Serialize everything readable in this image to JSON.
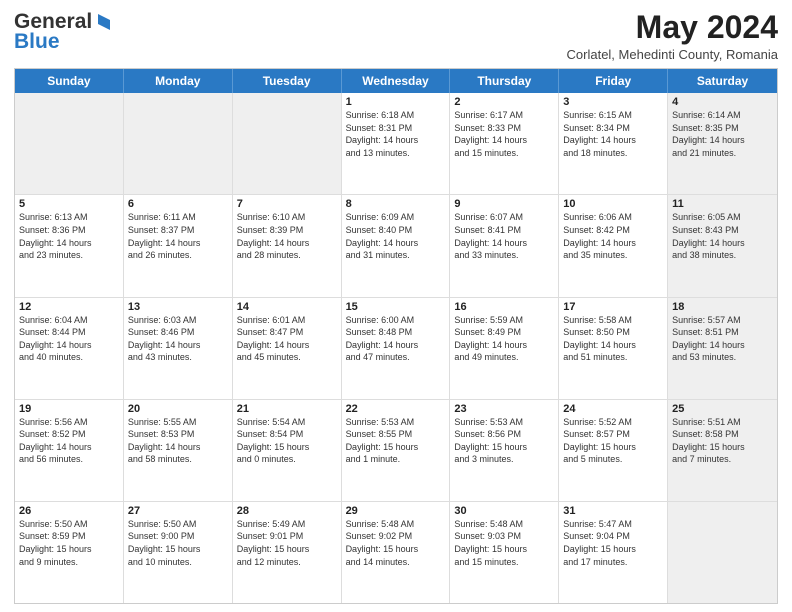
{
  "logo": {
    "line1": "General",
    "line2": "Blue"
  },
  "title": "May 2024",
  "location": "Corlatel, Mehedinti County, Romania",
  "weekdays": [
    "Sunday",
    "Monday",
    "Tuesday",
    "Wednesday",
    "Thursday",
    "Friday",
    "Saturday"
  ],
  "rows": [
    [
      {
        "day": "",
        "text": "",
        "shaded": true
      },
      {
        "day": "",
        "text": "",
        "shaded": true
      },
      {
        "day": "",
        "text": "",
        "shaded": true
      },
      {
        "day": "1",
        "text": "Sunrise: 6:18 AM\nSunset: 8:31 PM\nDaylight: 14 hours\nand 13 minutes."
      },
      {
        "day": "2",
        "text": "Sunrise: 6:17 AM\nSunset: 8:33 PM\nDaylight: 14 hours\nand 15 minutes."
      },
      {
        "day": "3",
        "text": "Sunrise: 6:15 AM\nSunset: 8:34 PM\nDaylight: 14 hours\nand 18 minutes."
      },
      {
        "day": "4",
        "text": "Sunrise: 6:14 AM\nSunset: 8:35 PM\nDaylight: 14 hours\nand 21 minutes.",
        "shaded": true
      }
    ],
    [
      {
        "day": "5",
        "text": "Sunrise: 6:13 AM\nSunset: 8:36 PM\nDaylight: 14 hours\nand 23 minutes."
      },
      {
        "day": "6",
        "text": "Sunrise: 6:11 AM\nSunset: 8:37 PM\nDaylight: 14 hours\nand 26 minutes."
      },
      {
        "day": "7",
        "text": "Sunrise: 6:10 AM\nSunset: 8:39 PM\nDaylight: 14 hours\nand 28 minutes."
      },
      {
        "day": "8",
        "text": "Sunrise: 6:09 AM\nSunset: 8:40 PM\nDaylight: 14 hours\nand 31 minutes."
      },
      {
        "day": "9",
        "text": "Sunrise: 6:07 AM\nSunset: 8:41 PM\nDaylight: 14 hours\nand 33 minutes."
      },
      {
        "day": "10",
        "text": "Sunrise: 6:06 AM\nSunset: 8:42 PM\nDaylight: 14 hours\nand 35 minutes."
      },
      {
        "day": "11",
        "text": "Sunrise: 6:05 AM\nSunset: 8:43 PM\nDaylight: 14 hours\nand 38 minutes.",
        "shaded": true
      }
    ],
    [
      {
        "day": "12",
        "text": "Sunrise: 6:04 AM\nSunset: 8:44 PM\nDaylight: 14 hours\nand 40 minutes."
      },
      {
        "day": "13",
        "text": "Sunrise: 6:03 AM\nSunset: 8:46 PM\nDaylight: 14 hours\nand 43 minutes."
      },
      {
        "day": "14",
        "text": "Sunrise: 6:01 AM\nSunset: 8:47 PM\nDaylight: 14 hours\nand 45 minutes."
      },
      {
        "day": "15",
        "text": "Sunrise: 6:00 AM\nSunset: 8:48 PM\nDaylight: 14 hours\nand 47 minutes."
      },
      {
        "day": "16",
        "text": "Sunrise: 5:59 AM\nSunset: 8:49 PM\nDaylight: 14 hours\nand 49 minutes."
      },
      {
        "day": "17",
        "text": "Sunrise: 5:58 AM\nSunset: 8:50 PM\nDaylight: 14 hours\nand 51 minutes."
      },
      {
        "day": "18",
        "text": "Sunrise: 5:57 AM\nSunset: 8:51 PM\nDaylight: 14 hours\nand 53 minutes.",
        "shaded": true
      }
    ],
    [
      {
        "day": "19",
        "text": "Sunrise: 5:56 AM\nSunset: 8:52 PM\nDaylight: 14 hours\nand 56 minutes."
      },
      {
        "day": "20",
        "text": "Sunrise: 5:55 AM\nSunset: 8:53 PM\nDaylight: 14 hours\nand 58 minutes."
      },
      {
        "day": "21",
        "text": "Sunrise: 5:54 AM\nSunset: 8:54 PM\nDaylight: 15 hours\nand 0 minutes."
      },
      {
        "day": "22",
        "text": "Sunrise: 5:53 AM\nSunset: 8:55 PM\nDaylight: 15 hours\nand 1 minute."
      },
      {
        "day": "23",
        "text": "Sunrise: 5:53 AM\nSunset: 8:56 PM\nDaylight: 15 hours\nand 3 minutes."
      },
      {
        "day": "24",
        "text": "Sunrise: 5:52 AM\nSunset: 8:57 PM\nDaylight: 15 hours\nand 5 minutes."
      },
      {
        "day": "25",
        "text": "Sunrise: 5:51 AM\nSunset: 8:58 PM\nDaylight: 15 hours\nand 7 minutes.",
        "shaded": true
      }
    ],
    [
      {
        "day": "26",
        "text": "Sunrise: 5:50 AM\nSunset: 8:59 PM\nDaylight: 15 hours\nand 9 minutes."
      },
      {
        "day": "27",
        "text": "Sunrise: 5:50 AM\nSunset: 9:00 PM\nDaylight: 15 hours\nand 10 minutes."
      },
      {
        "day": "28",
        "text": "Sunrise: 5:49 AM\nSunset: 9:01 PM\nDaylight: 15 hours\nand 12 minutes."
      },
      {
        "day": "29",
        "text": "Sunrise: 5:48 AM\nSunset: 9:02 PM\nDaylight: 15 hours\nand 14 minutes."
      },
      {
        "day": "30",
        "text": "Sunrise: 5:48 AM\nSunset: 9:03 PM\nDaylight: 15 hours\nand 15 minutes."
      },
      {
        "day": "31",
        "text": "Sunrise: 5:47 AM\nSunset: 9:04 PM\nDaylight: 15 hours\nand 17 minutes."
      },
      {
        "day": "",
        "text": "",
        "shaded": true
      }
    ]
  ]
}
